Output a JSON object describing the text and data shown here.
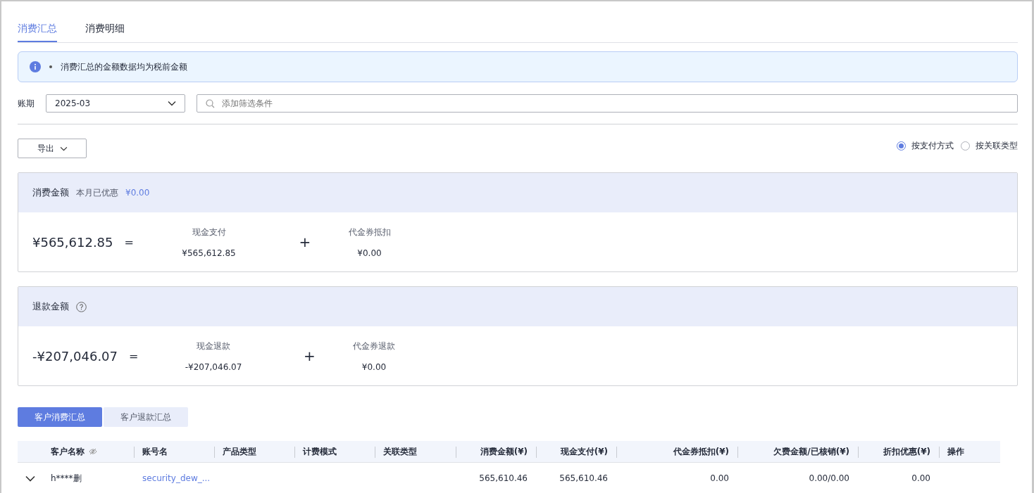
{
  "tabs": [
    {
      "label": "消费汇总",
      "selected": true
    },
    {
      "label": "消费明细",
      "selected": false
    }
  ],
  "notice": {
    "text": "消费汇总的金额数据均为税前金额"
  },
  "filters": {
    "period_label": "账期",
    "period_value": "2025-03",
    "search_placeholder": "添加筛选条件"
  },
  "export_button": "导出",
  "view_options": [
    {
      "label": "按支付方式",
      "selected": true
    },
    {
      "label": "按关联类型",
      "selected": false
    }
  ],
  "summaries": [
    {
      "title": "消费金额",
      "note": "本月已优惠",
      "note_value": "¥0.00",
      "help": false,
      "total": "¥565,612.85",
      "equals": "=",
      "parts": [
        {
          "label": "现金支付",
          "value": "¥565,612.85"
        },
        {
          "operator": "+",
          "label": "代金券抵扣",
          "value": "¥0.00"
        }
      ]
    },
    {
      "title": "退款金额",
      "help": true,
      "total": "-¥207,046.07",
      "equals": "=",
      "parts": [
        {
          "label": "现金退款",
          "value": "-¥207,046.07"
        },
        {
          "operator": "+",
          "label": "代金券退款",
          "value": "¥0.00"
        }
      ]
    }
  ],
  "sub_tabs": [
    {
      "label": "客户消费汇总",
      "selected": true
    },
    {
      "label": "客户退款汇总",
      "selected": false
    }
  ],
  "table": {
    "columns": [
      {
        "label": "客户名称",
        "kind": "text",
        "masked": true
      },
      {
        "label": "账号名",
        "kind": "link"
      },
      {
        "label": "产品类型",
        "kind": "text"
      },
      {
        "label": "计费模式",
        "kind": "text"
      },
      {
        "label": "关联类型",
        "kind": "text"
      },
      {
        "label": "消费金额(¥)",
        "kind": "amount"
      },
      {
        "label": "现金支付(¥)",
        "kind": "amount"
      },
      {
        "label": "代金券抵扣(¥)",
        "kind": "amount"
      },
      {
        "label": "欠费金额/已核销(¥)",
        "kind": "amount"
      },
      {
        "label": "折扣优惠(¥)",
        "kind": "amount"
      },
      {
        "label": "操作",
        "kind": "text"
      }
    ],
    "rows": [
      {
        "expanded": false,
        "cells": [
          "h****删",
          "security_dew_...",
          "",
          "",
          "",
          "565,610.46",
          "565,610.46",
          "0.00",
          "0.00/0.00",
          "0.00",
          ""
        ]
      }
    ]
  }
}
